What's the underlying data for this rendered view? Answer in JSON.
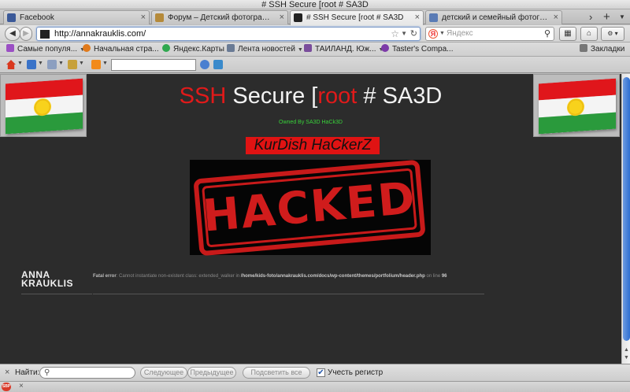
{
  "window": {
    "title": "# SSH Secure [root # SA3D"
  },
  "tabs": [
    {
      "label": "Facebook",
      "favicon_color": "#3b5998"
    },
    {
      "label": "Форум – Детский фотограф, вс...",
      "favicon_color": "#b58a3a"
    },
    {
      "label": "# SSH Secure [root # SA3D",
      "favicon_color": "#222222",
      "active": true
    },
    {
      "label": "детский и семейный фотограф...",
      "favicon_color": "#5a7bb5"
    }
  ],
  "nav": {
    "url": "http://annakrauklis.com/",
    "search_placeholder": "Яндекс",
    "search_engine_glyph": "Я"
  },
  "bookmarks": [
    {
      "label": "Самые популя...",
      "icon_color": "#9b4fc4",
      "dropdown": true
    },
    {
      "label": "Начальная стра...",
      "icon_color": "#e07a1c",
      "dropdown": false
    },
    {
      "label": "Яндекс.Карты",
      "icon_color": "#2fa84f",
      "dropdown": false
    },
    {
      "label": "Лента новостей",
      "icon_color": "#6a7b95",
      "dropdown": true
    },
    {
      "label": "ТАИЛАНД. Юж...",
      "icon_color": "#7a4d9c",
      "dropdown": true
    },
    {
      "label": "Taster's Compa...",
      "icon_color": "#7c3aa8",
      "dropdown": false
    }
  ],
  "bookmarks_menu_label": "Закладки",
  "page": {
    "headline_part1": "SSH",
    "headline_part2": " Secure [",
    "headline_part3": "root",
    "headline_part4": " # SA3D",
    "owned_by": "Owned By SA3D HaCk3D",
    "kurdish": "KurDish HaCkerZ",
    "hacked_word": "HACKED",
    "logo_line1": "ANNA",
    "logo_line2": "KRAUKLIS",
    "error_label": "Fatal error",
    "error_message": ": Cannot instantiate non-existent class: extended_walker in ",
    "error_path": "/home/kids-foto/annakrauklis.com/docs/wp-content/themes/portfolium/header.php",
    "error_line_text": " on line ",
    "error_line": "96"
  },
  "findbar": {
    "label": "Найти:",
    "next": "Следующее",
    "prev": "Предыдущее",
    "highlight": "Подсветить все",
    "match_case": "Учесть регистр",
    "match_case_checked": true
  },
  "colors": {
    "accent_red": "#e01a1a",
    "owned_green": "#38d33a",
    "page_bg": "#2c2c2c"
  }
}
